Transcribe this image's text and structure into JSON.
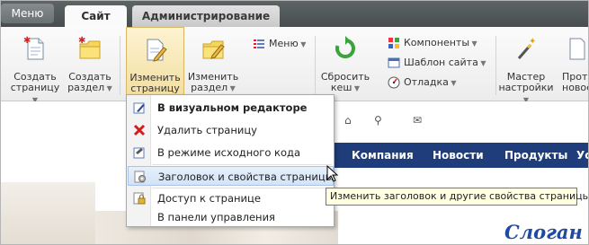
{
  "topbar": {
    "menu_label": "Меню",
    "tabs": [
      {
        "label": "Сайт",
        "active": true
      },
      {
        "label": "Администрирование",
        "active": false
      }
    ]
  },
  "toolbar": {
    "create_page": {
      "line1": "Создать",
      "line2": "страницу"
    },
    "create_section": {
      "line1": "Создать",
      "line2": "раздел"
    },
    "edit_page": {
      "line1": "Изменить",
      "line2": "страницу"
    },
    "edit_section": {
      "line1": "Изменить",
      "line2": "раздел"
    },
    "menu_item": "Меню",
    "reset_cache": {
      "line1": "Сбросить",
      "line2": "кеш"
    },
    "components": "Компоненты",
    "site_template": "Шаблон сайта",
    "debug": "Отладка",
    "wizard": {
      "line1": "Мастер",
      "line2": "настройки"
    },
    "cut_item": {
      "line1": "Прото",
      "line2": "новое"
    }
  },
  "dropdown": {
    "items": [
      {
        "label": "В визуальном редакторе",
        "icon": "visual-editor-icon",
        "bold": true
      },
      {
        "label": "Удалить страницу",
        "icon": "delete-icon"
      },
      {
        "label": "В режиме исходного кода",
        "icon": "source-code-icon"
      },
      {
        "label": "Заголовок и свойства страницы",
        "icon": "page-properties-icon",
        "hover": true
      },
      {
        "label": "Доступ к странице",
        "icon": "lock-icon"
      },
      {
        "label": "В панели управления",
        "icon": ""
      }
    ]
  },
  "tooltip": "Изменить заголовок и другие свойства страницы",
  "site": {
    "nav": [
      "Компания",
      "Новости",
      "Продукты",
      "Ус"
    ],
    "slogan": "Слоган"
  },
  "colors": {
    "tabstrip": "#4f5557",
    "active_button": "#f2dd9e",
    "navbar": "#1e3d7a",
    "slogan": "#1e4aa1",
    "tooltip_bg": "#ffffe1"
  }
}
